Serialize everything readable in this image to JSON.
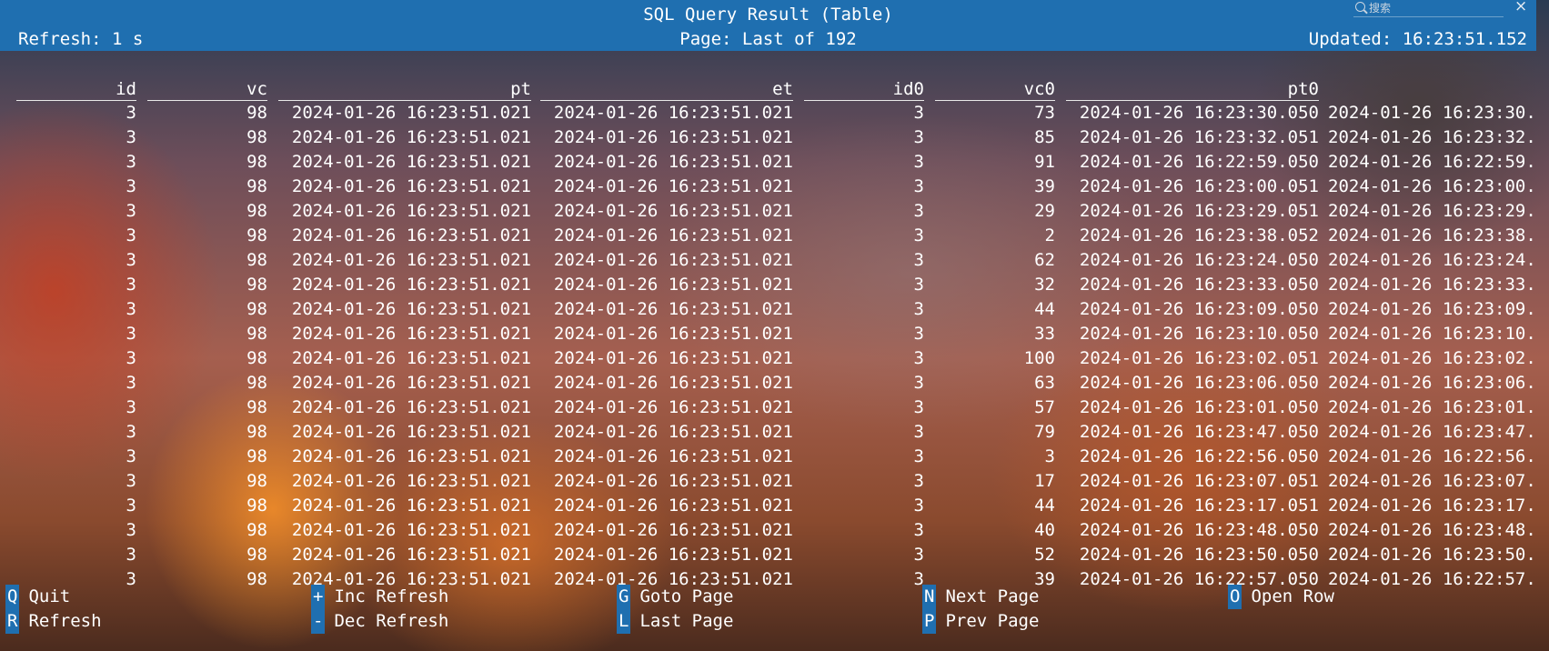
{
  "header": {
    "title": "SQL Query Result (Table)",
    "refresh": "Refresh: 1 s",
    "page": "Page: Last of 192",
    "updated": "Updated: 16:23:51.152"
  },
  "search": {
    "placeholder": "搜索"
  },
  "table": {
    "columns": [
      "id",
      "vc",
      "pt",
      "et",
      "id0",
      "vc0",
      "pt0",
      ""
    ],
    "rows": [
      [
        "3",
        "98",
        "2024-01-26 16:23:51.021",
        "2024-01-26 16:23:51.021",
        "3",
        "73",
        "2024-01-26 16:23:30.050",
        "2024-01-26 16:23:30."
      ],
      [
        "3",
        "98",
        "2024-01-26 16:23:51.021",
        "2024-01-26 16:23:51.021",
        "3",
        "85",
        "2024-01-26 16:23:32.051",
        "2024-01-26 16:23:32."
      ],
      [
        "3",
        "98",
        "2024-01-26 16:23:51.021",
        "2024-01-26 16:23:51.021",
        "3",
        "91",
        "2024-01-26 16:22:59.050",
        "2024-01-26 16:22:59."
      ],
      [
        "3",
        "98",
        "2024-01-26 16:23:51.021",
        "2024-01-26 16:23:51.021",
        "3",
        "39",
        "2024-01-26 16:23:00.051",
        "2024-01-26 16:23:00."
      ],
      [
        "3",
        "98",
        "2024-01-26 16:23:51.021",
        "2024-01-26 16:23:51.021",
        "3",
        "29",
        "2024-01-26 16:23:29.051",
        "2024-01-26 16:23:29."
      ],
      [
        "3",
        "98",
        "2024-01-26 16:23:51.021",
        "2024-01-26 16:23:51.021",
        "3",
        "2",
        "2024-01-26 16:23:38.052",
        "2024-01-26 16:23:38."
      ],
      [
        "3",
        "98",
        "2024-01-26 16:23:51.021",
        "2024-01-26 16:23:51.021",
        "3",
        "62",
        "2024-01-26 16:23:24.050",
        "2024-01-26 16:23:24."
      ],
      [
        "3",
        "98",
        "2024-01-26 16:23:51.021",
        "2024-01-26 16:23:51.021",
        "3",
        "32",
        "2024-01-26 16:23:33.050",
        "2024-01-26 16:23:33."
      ],
      [
        "3",
        "98",
        "2024-01-26 16:23:51.021",
        "2024-01-26 16:23:51.021",
        "3",
        "44",
        "2024-01-26 16:23:09.050",
        "2024-01-26 16:23:09."
      ],
      [
        "3",
        "98",
        "2024-01-26 16:23:51.021",
        "2024-01-26 16:23:51.021",
        "3",
        "33",
        "2024-01-26 16:23:10.050",
        "2024-01-26 16:23:10."
      ],
      [
        "3",
        "98",
        "2024-01-26 16:23:51.021",
        "2024-01-26 16:23:51.021",
        "3",
        "100",
        "2024-01-26 16:23:02.051",
        "2024-01-26 16:23:02."
      ],
      [
        "3",
        "98",
        "2024-01-26 16:23:51.021",
        "2024-01-26 16:23:51.021",
        "3",
        "63",
        "2024-01-26 16:23:06.050",
        "2024-01-26 16:23:06."
      ],
      [
        "3",
        "98",
        "2024-01-26 16:23:51.021",
        "2024-01-26 16:23:51.021",
        "3",
        "57",
        "2024-01-26 16:23:01.050",
        "2024-01-26 16:23:01."
      ],
      [
        "3",
        "98",
        "2024-01-26 16:23:51.021",
        "2024-01-26 16:23:51.021",
        "3",
        "79",
        "2024-01-26 16:23:47.050",
        "2024-01-26 16:23:47."
      ],
      [
        "3",
        "98",
        "2024-01-26 16:23:51.021",
        "2024-01-26 16:23:51.021",
        "3",
        "3",
        "2024-01-26 16:22:56.050",
        "2024-01-26 16:22:56."
      ],
      [
        "3",
        "98",
        "2024-01-26 16:23:51.021",
        "2024-01-26 16:23:51.021",
        "3",
        "17",
        "2024-01-26 16:23:07.051",
        "2024-01-26 16:23:07."
      ],
      [
        "3",
        "98",
        "2024-01-26 16:23:51.021",
        "2024-01-26 16:23:51.021",
        "3",
        "44",
        "2024-01-26 16:23:17.051",
        "2024-01-26 16:23:17."
      ],
      [
        "3",
        "98",
        "2024-01-26 16:23:51.021",
        "2024-01-26 16:23:51.021",
        "3",
        "40",
        "2024-01-26 16:23:48.050",
        "2024-01-26 16:23:48."
      ],
      [
        "3",
        "98",
        "2024-01-26 16:23:51.021",
        "2024-01-26 16:23:51.021",
        "3",
        "52",
        "2024-01-26 16:23:50.050",
        "2024-01-26 16:23:50."
      ],
      [
        "3",
        "98",
        "2024-01-26 16:23:51.021",
        "2024-01-26 16:23:51.021",
        "3",
        "39",
        "2024-01-26 16:22:57.050",
        "2024-01-26 16:22:57."
      ]
    ]
  },
  "footer": {
    "items": [
      {
        "key": "Q",
        "label": "Quit"
      },
      {
        "key": "R",
        "label": "Refresh"
      },
      {
        "key": "+",
        "label": "Inc Refresh"
      },
      {
        "key": "-",
        "label": "Dec Refresh"
      },
      {
        "key": "G",
        "label": "Goto Page"
      },
      {
        "key": "L",
        "label": "Last Page"
      },
      {
        "key": "N",
        "label": "Next Page"
      },
      {
        "key": "P",
        "label": "Prev Page"
      },
      {
        "key": "O",
        "label": "Open Row"
      }
    ]
  },
  "colors": {
    "header_bg": "#1f6fb0",
    "text": "#ffffff"
  }
}
